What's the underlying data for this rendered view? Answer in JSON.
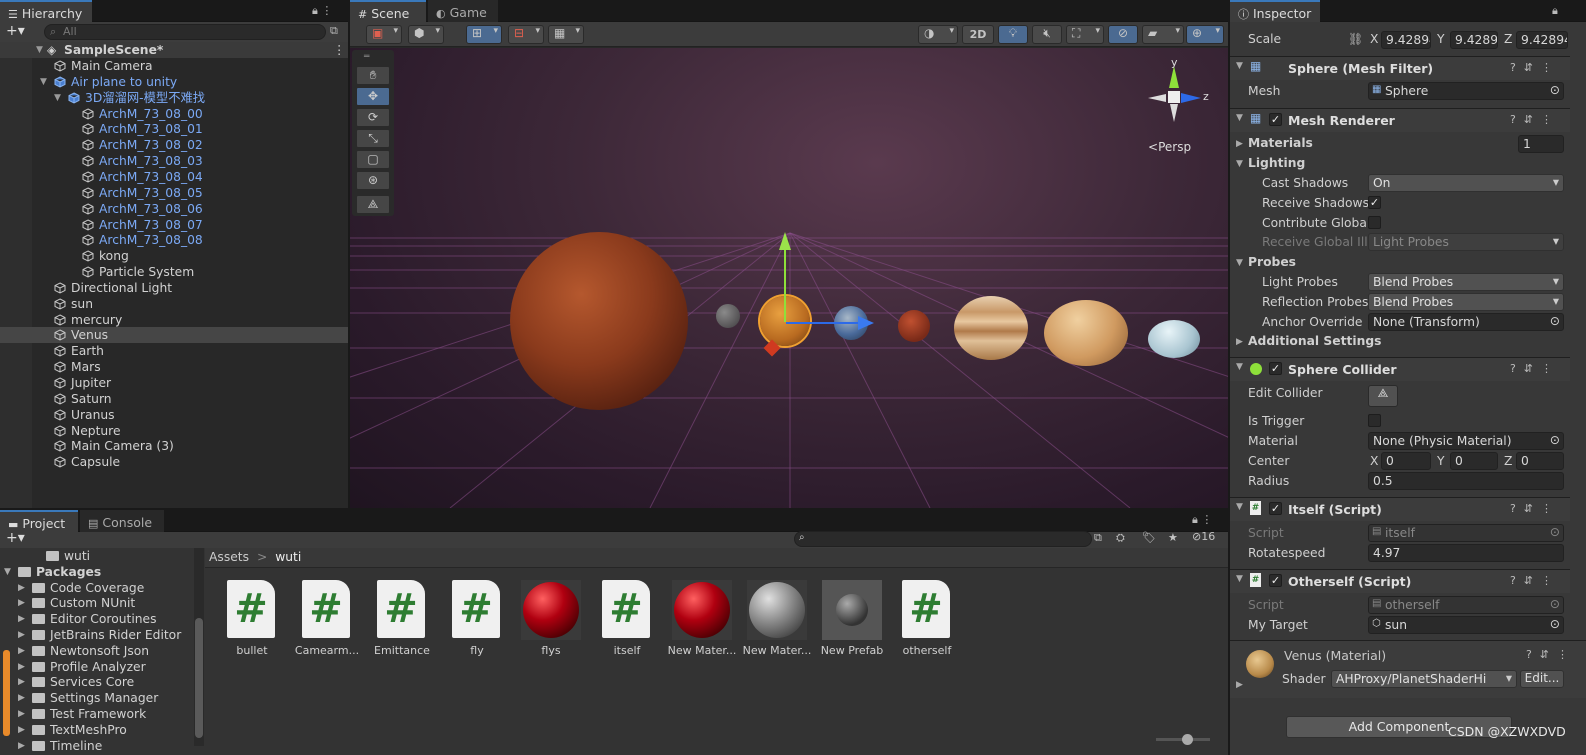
{
  "hierarchy": {
    "tab": "Hierarchy",
    "search_placeholder": "All",
    "scene": "SampleScene*",
    "items": [
      {
        "label": "Main Camera",
        "indent": 1,
        "kind": "cube"
      },
      {
        "label": "Air plane to unity",
        "indent": 1,
        "kind": "prefab",
        "color": "blue",
        "expanded": true
      },
      {
        "label": "3D溜溜网-模型不难找",
        "indent": 2,
        "kind": "prefab",
        "color": "blue",
        "expanded": true
      },
      {
        "label": "ArchM_73_08_00",
        "indent": 3,
        "kind": "cube",
        "color": "blue"
      },
      {
        "label": "ArchM_73_08_01",
        "indent": 3,
        "kind": "cube",
        "color": "blue"
      },
      {
        "label": "ArchM_73_08_02",
        "indent": 3,
        "kind": "cube",
        "color": "blue"
      },
      {
        "label": "ArchM_73_08_03",
        "indent": 3,
        "kind": "cube",
        "color": "blue"
      },
      {
        "label": "ArchM_73_08_04",
        "indent": 3,
        "kind": "cube",
        "color": "blue"
      },
      {
        "label": "ArchM_73_08_05",
        "indent": 3,
        "kind": "cube",
        "color": "blue"
      },
      {
        "label": "ArchM_73_08_06",
        "indent": 3,
        "kind": "cube",
        "color": "blue"
      },
      {
        "label": "ArchM_73_08_07",
        "indent": 3,
        "kind": "cube",
        "color": "blue"
      },
      {
        "label": "ArchM_73_08_08",
        "indent": 3,
        "kind": "cube",
        "color": "blue"
      },
      {
        "label": "kong",
        "indent": 3,
        "kind": "cube"
      },
      {
        "label": "Particle System",
        "indent": 3,
        "kind": "cube"
      },
      {
        "label": "Directional Light",
        "indent": 1,
        "kind": "cube"
      },
      {
        "label": "sun",
        "indent": 1,
        "kind": "cube"
      },
      {
        "label": "mercury",
        "indent": 1,
        "kind": "cube"
      },
      {
        "label": "Venus",
        "indent": 1,
        "kind": "cube",
        "selected": true
      },
      {
        "label": "Earth",
        "indent": 1,
        "kind": "cube"
      },
      {
        "label": "Mars",
        "indent": 1,
        "kind": "cube"
      },
      {
        "label": "Jupiter",
        "indent": 1,
        "kind": "cube"
      },
      {
        "label": "Saturn",
        "indent": 1,
        "kind": "cube"
      },
      {
        "label": "Uranus",
        "indent": 1,
        "kind": "cube"
      },
      {
        "label": "Nepture",
        "indent": 1,
        "kind": "cube"
      },
      {
        "label": "Main Camera (3)",
        "indent": 1,
        "kind": "cube"
      },
      {
        "label": "Capsule",
        "indent": 1,
        "kind": "cube"
      }
    ]
  },
  "scene": {
    "tab_scene": "Scene",
    "tab_game": "Game",
    "btn_2d": "2D",
    "persp": "Persp",
    "gizmo": {
      "y": "y",
      "z": "z"
    },
    "tools": [
      "hand",
      "move",
      "rotate",
      "scale",
      "rect",
      "transform",
      "custom"
    ]
  },
  "inspector": {
    "tab": "Inspector",
    "transform": {
      "scale_label": "Scale",
      "x": "9.42894",
      "y": "9.42894",
      "z": "9.42894",
      "X": "X",
      "Y": "Y",
      "Z": "Z"
    },
    "mesh_filter": {
      "title": "Sphere (Mesh Filter)",
      "mesh_label": "Mesh",
      "mesh_value": "Sphere"
    },
    "mesh_renderer": {
      "title": "Mesh Renderer",
      "materials": "Materials",
      "materials_count": "1",
      "lighting": "Lighting",
      "cast_shadows": "Cast Shadows",
      "cast_shadows_value": "On",
      "receive_shadows": "Receive Shadows",
      "contribute_gi": "Contribute Global I",
      "receive_gi": "Receive Global Illu",
      "receive_gi_value": "Light Probes",
      "probes": "Probes",
      "light_probes": "Light Probes",
      "light_probes_value": "Blend Probes",
      "reflection_probes": "Reflection Probes",
      "reflection_probes_value": "Blend Probes",
      "anchor_override": "Anchor Override",
      "anchor_override_value": "None (Transform)",
      "additional": "Additional Settings"
    },
    "sphere_collider": {
      "title": "Sphere Collider",
      "edit_collider": "Edit Collider",
      "is_trigger": "Is Trigger",
      "material": "Material",
      "material_value": "None (Physic Material)",
      "center": "Center",
      "cx": "0",
      "cy": "0",
      "cz": "0",
      "radius": "Radius",
      "radius_value": "0.5"
    },
    "itself": {
      "title": "Itself (Script)",
      "script_label": "Script",
      "script_value": "itself",
      "rotatespeed": "Rotatespeed",
      "rotatespeed_value": "4.97"
    },
    "otherself": {
      "title": "Otherself (Script)",
      "script_label": "Script",
      "script_value": "otherself",
      "target_label": "My Target",
      "target_value": "sun"
    },
    "material": {
      "title": "Venus (Material)",
      "shader_label": "Shader",
      "shader_value": "AHProxy/PlanetShaderHi",
      "edit": "Edit..."
    },
    "add_component": "Add Component"
  },
  "project": {
    "tab_project": "Project",
    "tab_console": "Console",
    "hidden_count": "16",
    "tree": [
      {
        "label": "wuti",
        "indent": 2,
        "arrow": false
      },
      {
        "label": "Packages",
        "indent": 0,
        "arrow": true,
        "open": true,
        "bold": true
      },
      {
        "label": "Code Coverage",
        "indent": 1,
        "arrow": true
      },
      {
        "label": "Custom NUnit",
        "indent": 1,
        "arrow": true
      },
      {
        "label": "Editor Coroutines",
        "indent": 1,
        "arrow": true
      },
      {
        "label": "JetBrains Rider Editor",
        "indent": 1,
        "arrow": true
      },
      {
        "label": "Newtonsoft Json",
        "indent": 1,
        "arrow": true
      },
      {
        "label": "Profile Analyzer",
        "indent": 1,
        "arrow": true
      },
      {
        "label": "Services Core",
        "indent": 1,
        "arrow": true
      },
      {
        "label": "Settings Manager",
        "indent": 1,
        "arrow": true
      },
      {
        "label": "Test Framework",
        "indent": 1,
        "arrow": true
      },
      {
        "label": "TextMeshPro",
        "indent": 1,
        "arrow": true
      },
      {
        "label": "Timeline",
        "indent": 1,
        "arrow": true
      }
    ],
    "breadcrumb": {
      "root": "Assets",
      "sep": ">",
      "current": "wuti"
    },
    "assets": [
      {
        "name": "bullet",
        "type": "script"
      },
      {
        "name": "Camearm...",
        "type": "script"
      },
      {
        "name": "Emittance",
        "type": "script"
      },
      {
        "name": "fly",
        "type": "script"
      },
      {
        "name": "flys",
        "type": "material-red-small"
      },
      {
        "name": "itself",
        "type": "script"
      },
      {
        "name": "New Mater...",
        "type": "material-red"
      },
      {
        "name": "New Mater...",
        "type": "material-gray"
      },
      {
        "name": "New Prefab",
        "type": "prefab"
      },
      {
        "name": "otherself",
        "type": "script"
      }
    ]
  },
  "watermark": "CSDN @XZWXDVD"
}
